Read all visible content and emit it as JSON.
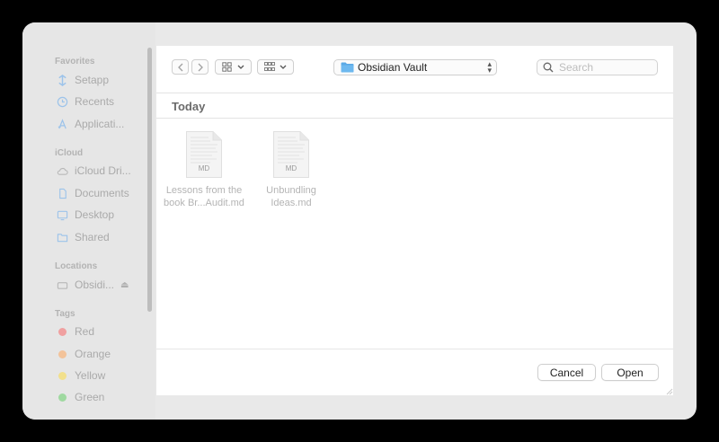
{
  "sidebar": {
    "favorites": {
      "title": "Favorites",
      "items": [
        {
          "label": "Setapp",
          "icon": "setapp-icon"
        },
        {
          "label": "Recents",
          "icon": "clock-icon"
        },
        {
          "label": "Applicati...",
          "icon": "applications-icon"
        }
      ]
    },
    "icloud": {
      "title": "iCloud",
      "items": [
        {
          "label": "iCloud Dri...",
          "icon": "cloud-icon"
        },
        {
          "label": "Documents",
          "icon": "document-icon"
        },
        {
          "label": "Desktop",
          "icon": "desktop-icon"
        },
        {
          "label": "Shared",
          "icon": "shared-folder-icon"
        }
      ]
    },
    "locations": {
      "title": "Locations",
      "items": [
        {
          "label": "Obsidi...",
          "icon": "drive-icon"
        }
      ]
    },
    "tags": {
      "title": "Tags",
      "items": [
        {
          "label": "Red",
          "color": "#f0a0a0"
        },
        {
          "label": "Orange",
          "color": "#f3c39a"
        },
        {
          "label": "Yellow",
          "color": "#f2e08c"
        },
        {
          "label": "Green",
          "color": "#9fd9a0"
        }
      ]
    }
  },
  "toolbar": {
    "back_icon": "chevron-left-icon",
    "forward_icon": "chevron-right-icon",
    "view_icon": "icon-grid-icon",
    "group_icon": "group-grid-icon",
    "location": "Obsidian Vault",
    "search_placeholder": "Search"
  },
  "group": {
    "title": "Today"
  },
  "files": [
    {
      "badge": "MD",
      "name_line1": "Lessons from the",
      "name_line2": "book Br...Audit.md"
    },
    {
      "badge": "MD",
      "name_line1": "Unbundling",
      "name_line2": "Ideas.md"
    }
  ],
  "footer": {
    "cancel_label": "Cancel",
    "open_label": "Open"
  },
  "colors": {
    "folder": "#5aa9e6",
    "setapp": "#8ab8e8"
  }
}
